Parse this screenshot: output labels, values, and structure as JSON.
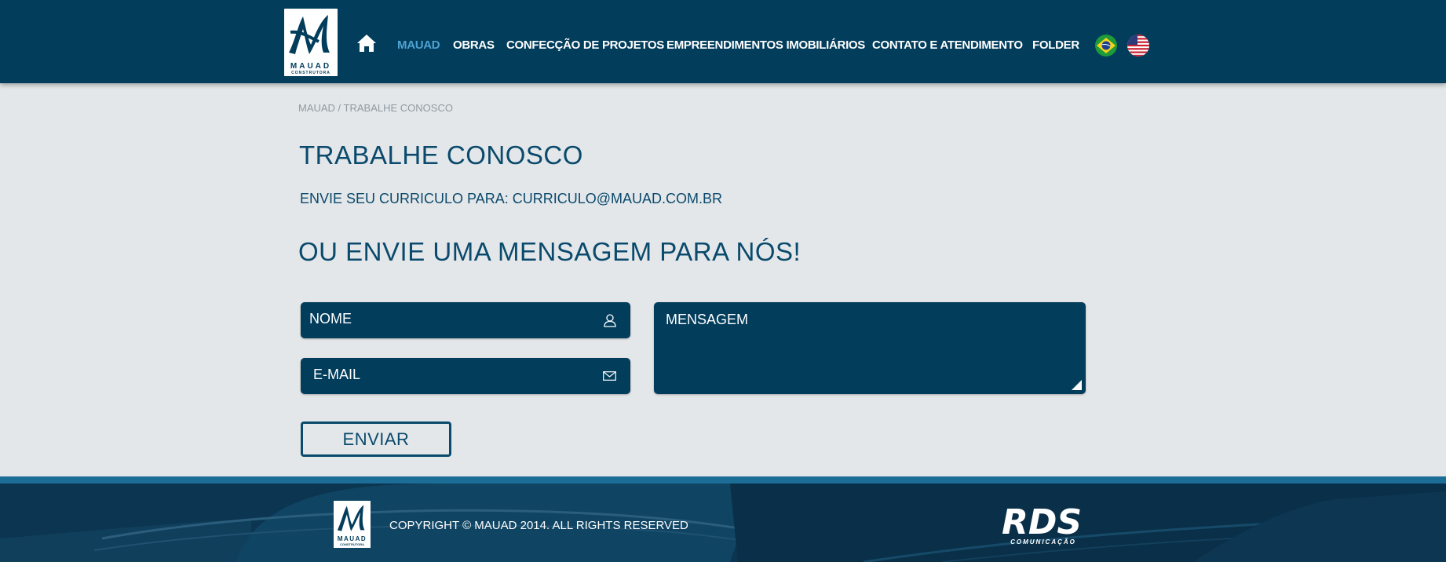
{
  "brand": {
    "logo_name": "MAUAD",
    "logo_tagline": "CONSTRUTORA"
  },
  "nav": {
    "items": [
      {
        "label": "MAUAD",
        "active": true
      },
      {
        "label": "OBRAS",
        "active": false
      },
      {
        "label": "CONFECÇÃO DE PROJETOS",
        "active": false
      },
      {
        "label": "EMPREENDIMENTOS IMOBILIÁRIOS",
        "active": false
      },
      {
        "label": "CONTATO E ATENDIMENTO",
        "active": false
      },
      {
        "label": "FOLDER",
        "active": false
      }
    ],
    "icons": {
      "home": "home-icon",
      "flag_br": "flag-brazil-icon",
      "flag_us": "flag-usa-icon"
    }
  },
  "breadcrumb": "MAUAD / TRABALHE CONOSCO",
  "page": {
    "title": "TRABALHE CONOSCO",
    "cv_text": "ENVIE SEU CURRICULO PARA: CURRICULO@MAUAD.COM.BR",
    "subtitle": "OU ENVIE UMA MENSAGEM PARA NÓS!"
  },
  "form": {
    "name_placeholder": "NOME",
    "email_placeholder": "E-MAIL",
    "message_placeholder": "MENSAGEM",
    "submit_label": "ENVIAR",
    "icons": {
      "name": "user-icon",
      "email": "envelope-icon",
      "resize": "resize-handle-icon"
    }
  },
  "footer": {
    "copyright": "COPYRIGHT © MAUAD 2014. ALL RIGHTS RESERVED",
    "agency_name": "RDS",
    "agency_tagline": "COMUNICAÇÃO"
  },
  "colors": {
    "header_bg": "#023d5c",
    "accent": "#4ea3d4",
    "text_dark": "#0a4a6c",
    "page_bg": "#e4e7e9",
    "footer_bg": "#0c3a55"
  }
}
